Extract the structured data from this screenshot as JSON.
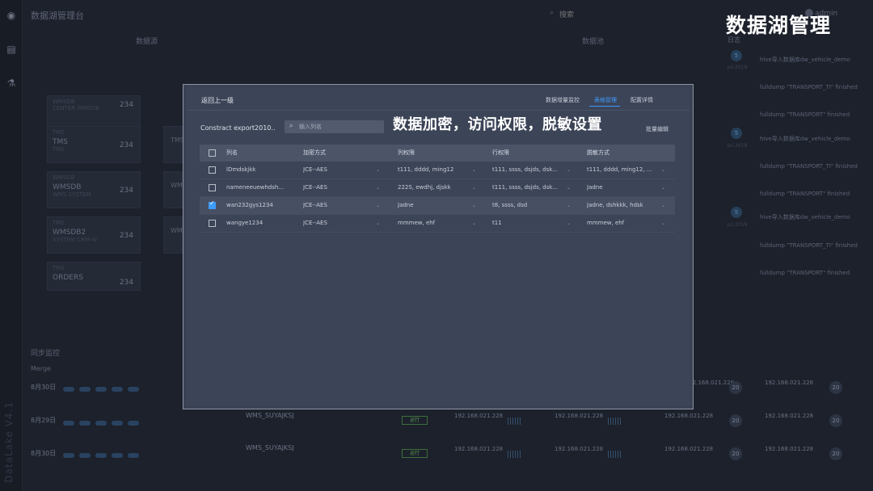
{
  "app": {
    "title": "数据湖管理台",
    "brand_overlay": "数据湖管理",
    "version": "DataLake V4.1",
    "user": "admin",
    "search_placeholder": "搜索"
  },
  "background": {
    "section_left": "数据源",
    "section_right": "数据池",
    "right_panel_title": "日志",
    "source_cards": [
      {
        "kind": "WMSDB",
        "name": "WMSDB",
        "sub": "CENTER WMSDB",
        "value": "234"
      },
      {
        "kind": "TMS",
        "name": "TMS",
        "sub": "TMS",
        "value": "234"
      },
      {
        "kind": "WMSDB",
        "name": "WMSDB",
        "sub": "WMS SYSTEM",
        "value": "234"
      },
      {
        "kind": "TMS",
        "name": "WMSDB2",
        "sub": "SYSTEM CRM-W",
        "value": "234"
      },
      {
        "kind": "TMS",
        "name": "ORDERS",
        "sub": "",
        "value": "234"
      }
    ],
    "logs": [
      {
        "num": "5",
        "date": "Jul.2019",
        "items": [
          "hive导入数据库dw_vehicle_demo",
          "fulldump \"TRANSPORT_TI\" finished",
          "fulldump \"TRANSPORT\" finished"
        ]
      },
      {
        "num": "5",
        "date": "Jul.2019",
        "items": [
          "hive导入数据库dw_vehicle_demo",
          "fulldump \"TRANSPORT_TI\" finished",
          "fulldump \"TRANSPORT\" finished"
        ]
      },
      {
        "num": "5",
        "date": "Jul.2019",
        "items": [
          "hive导入数据库dw_vehicle_demo",
          "fulldump \"TRANSPORT_TI\" finished",
          "fulldump \"TRANSPORT\" finished"
        ]
      }
    ],
    "sync": {
      "title": "同步监控",
      "group": "Merge",
      "rows": [
        {
          "date": "8月30日",
          "wms": "",
          "ip1": "192.168.021.228",
          "ip2": "192.168.021.228",
          "count": "20"
        },
        {
          "date": "8月29日",
          "wms": "WMS_SUYAJKSJ",
          "ip1": "192.168.021.228",
          "ip2": "192.168.021.228",
          "count": "20"
        },
        {
          "date": "8月30日",
          "wms": "WMS_SUYAJKSJ",
          "ip1": "192.168.021.228",
          "ip2": "192.168.021.228",
          "count": "20"
        }
      ],
      "badge": "运行"
    }
  },
  "modal": {
    "back_label": "返回上一级",
    "tabs": [
      {
        "label": "数据增量监控",
        "active": false
      },
      {
        "label": "表格管理",
        "active": true
      },
      {
        "label": "配置详情",
        "active": false
      }
    ],
    "db_name": "Constract export2010..",
    "search_placeholder": "输入列名",
    "batch_edit": "批量编辑",
    "feature_caption": "数据加密，访问权限，脱敏设置",
    "columns": [
      "列名",
      "加密方式",
      "列权限",
      "行权限",
      "脱敏方式"
    ],
    "rows": [
      {
        "checked": false,
        "name": "lDmdskjkk",
        "encrypt": "JCE--AES",
        "col_perm": "t111, dddd, ming12",
        "row_perm": "t111,  ssss, dsjds, dsk...",
        "mask": "t111, dddd, ming12, ..."
      },
      {
        "checked": false,
        "name": "nameneeuewhdsh...",
        "encrypt": "JCE--AES",
        "col_perm": "222S, ewdhj, djskk",
        "row_perm": "t111,  ssss, dsjds, dsk...",
        "mask": "Jadne"
      },
      {
        "checked": true,
        "name": "wan232gys1234",
        "encrypt": "JCE--AES",
        "col_perm": "Jadne",
        "row_perm": "t8, ssss, dsd",
        "mask": "Jadne,  dshkkk, hdsk"
      },
      {
        "checked": false,
        "name": "wangye1234",
        "encrypt": "JCE--AES",
        "col_perm": "mmmew, ehf",
        "row_perm": "t11",
        "mask": "mmmew, ehf"
      }
    ]
  }
}
